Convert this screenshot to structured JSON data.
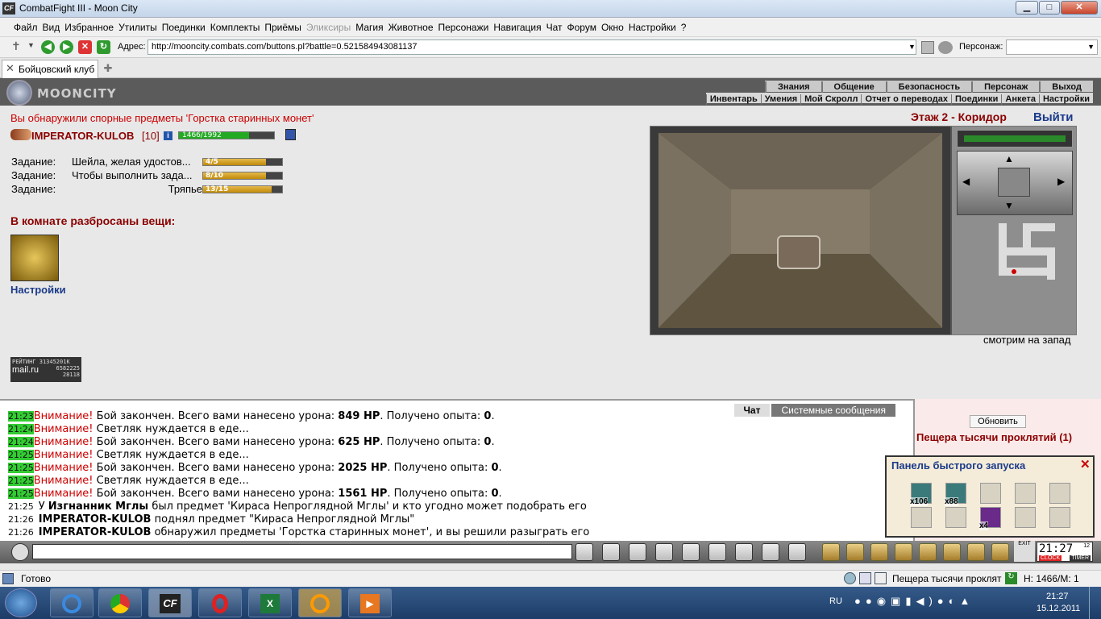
{
  "window": {
    "title": "CombatFight III - Moon City",
    "minimize": "▁",
    "maximize": "□",
    "close": "✕"
  },
  "menu": [
    {
      "label": "Файл"
    },
    {
      "label": "Вид"
    },
    {
      "label": "Избранное"
    },
    {
      "label": "Утилиты"
    },
    {
      "label": "Поединки"
    },
    {
      "label": "Комплекты"
    },
    {
      "label": "Приёмы"
    },
    {
      "label": "Эликсиры",
      "disabled": true
    },
    {
      "label": "Магия"
    },
    {
      "label": "Животное"
    },
    {
      "label": "Персонажи"
    },
    {
      "label": "Навигация"
    },
    {
      "label": "Чат"
    },
    {
      "label": "Форум"
    },
    {
      "label": "Окно"
    },
    {
      "label": "Настройки"
    },
    {
      "label": "?"
    }
  ],
  "address": {
    "label": "Адрес:",
    "url": "http://mooncity.combats.com/buttons.pl?battle=0.521584943081137",
    "character_label": "Персонаж:"
  },
  "tabs": [
    {
      "label": "Бойцовский клуб"
    }
  ],
  "game": {
    "logo": "MOONCITY",
    "nav1": [
      "Знания",
      "Общение",
      "Безопасность",
      "Персонаж",
      "Выход"
    ],
    "nav2": [
      "Инвентарь",
      "Умения",
      "Мой Скролл",
      "Отчет о переводах",
      "Поединки",
      "Анкета",
      "Настройки"
    ],
    "notice": "Вы обнаружили спорные предметы 'Горстка старинных монет'",
    "player": {
      "name": "IMPERATOR-KULOB",
      "level": "[10]",
      "hp_text": "1466/1992",
      "hp_fraction": 0.736
    },
    "quests": [
      {
        "label": "Задание:",
        "text": "Шейла, желая удостов...",
        "progress": "4/5",
        "fraction": 0.8
      },
      {
        "label": "Задание:",
        "text": "Чтобы выполнить зада...",
        "progress": "8/10",
        "fraction": 0.8
      },
      {
        "label": "Задание:",
        "text": "Тряпье",
        "progress": "13/15",
        "fraction": 0.867
      }
    ],
    "room_items_heading": "В комнате разбросаны вещи:",
    "settings_link": "Настройки",
    "rating": {
      "title": "РЕЙТИНГ",
      "n1": "31345201K",
      "brand": "mail.ru",
      "n2": "6582225",
      "n3": "28118"
    },
    "location": "Этаж 2 - Коридор",
    "exit_link": "Выйти",
    "view_caption": "смотрим на запад"
  },
  "chat": {
    "tabs": [
      "Чат",
      "Системные сообщения"
    ],
    "lines": [
      {
        "time": "21:23",
        "warn": "Внимание!",
        "text": " Бой закончен. Всего вами нанесено урона: ",
        "b1": "849 HP",
        "text2": ". Получено опыта: ",
        "b2": "0",
        "text3": "."
      },
      {
        "time": "21:24",
        "warn": "Внимание!",
        "text": " Светляк нуждается в еде...",
        "b1": "",
        "text2": "",
        "b2": "",
        "text3": ""
      },
      {
        "time": "21:24",
        "warn": "Внимание!",
        "text": " Бой закончен. Всего вами нанесено урона: ",
        "b1": "625 HP",
        "text2": ". Получено опыта: ",
        "b2": "0",
        "text3": "."
      },
      {
        "time": "21:25",
        "warn": "Внимание!",
        "text": " Светляк нуждается в еде...",
        "b1": "",
        "text2": "",
        "b2": "",
        "text3": ""
      },
      {
        "time": "21:25",
        "warn": "Внимание!",
        "text": " Бой закончен. Всего вами нанесено урона: ",
        "b1": "2025 HP",
        "text2": ". Получено опыта: ",
        "b2": "0",
        "text3": "."
      },
      {
        "time": "21:25",
        "warn": "Внимание!",
        "text": " Светляк нуждается в еде...",
        "b1": "",
        "text2": "",
        "b2": "",
        "text3": ""
      },
      {
        "time": "21:25",
        "warn": "Внимание!",
        "text": " Бой закончен. Всего вами нанесено урона: ",
        "b1": "1561 HP",
        "text2": ". Получено опыта: ",
        "b2": "0",
        "text3": "."
      }
    ],
    "sys_lines": [
      {
        "time": "21:25",
        "pre": "У ",
        "name": "Изгнанник Мглы",
        "rest": " был предмет 'Кираса Непроглядной Мглы' и кто угодно может подобрать его"
      },
      {
        "time": "21:26",
        "pre": "",
        "name": "IMPERATOR-KULOB",
        "rest": " поднял предмет \"Кираса Непроглядной Мглы\""
      },
      {
        "time": "21:26",
        "pre": "",
        "name": "IMPERATOR-KULOB",
        "rest": " обнаружил предметы 'Горстка старинных монет', и вы решили разыграть его"
      }
    ]
  },
  "right_panel": {
    "refresh": "Обновить",
    "location": "Пещера тысячи проклятий (1)"
  },
  "quick_panel": {
    "title": "Панель быстрого запуска",
    "close": "✕",
    "counts": [
      "x106",
      "x88",
      "x4"
    ]
  },
  "clock": {
    "time": "21:27",
    "sec": "12",
    "clock": "CLOCK",
    "timer": "TIMER",
    "exit": "EXIT"
  },
  "status": {
    "text": "Готово",
    "location": "Пещера тысячи проклят",
    "hpm": "H: 1466/M: 1"
  },
  "taskbar": {
    "lang": "RU",
    "time": "21:27",
    "date": "15.12.2011"
  },
  "colors": {
    "accent_red": "#cc0000",
    "title_red": "#8b0000",
    "link_blue": "#1a3a8a",
    "hp_green": "#22aa22"
  }
}
